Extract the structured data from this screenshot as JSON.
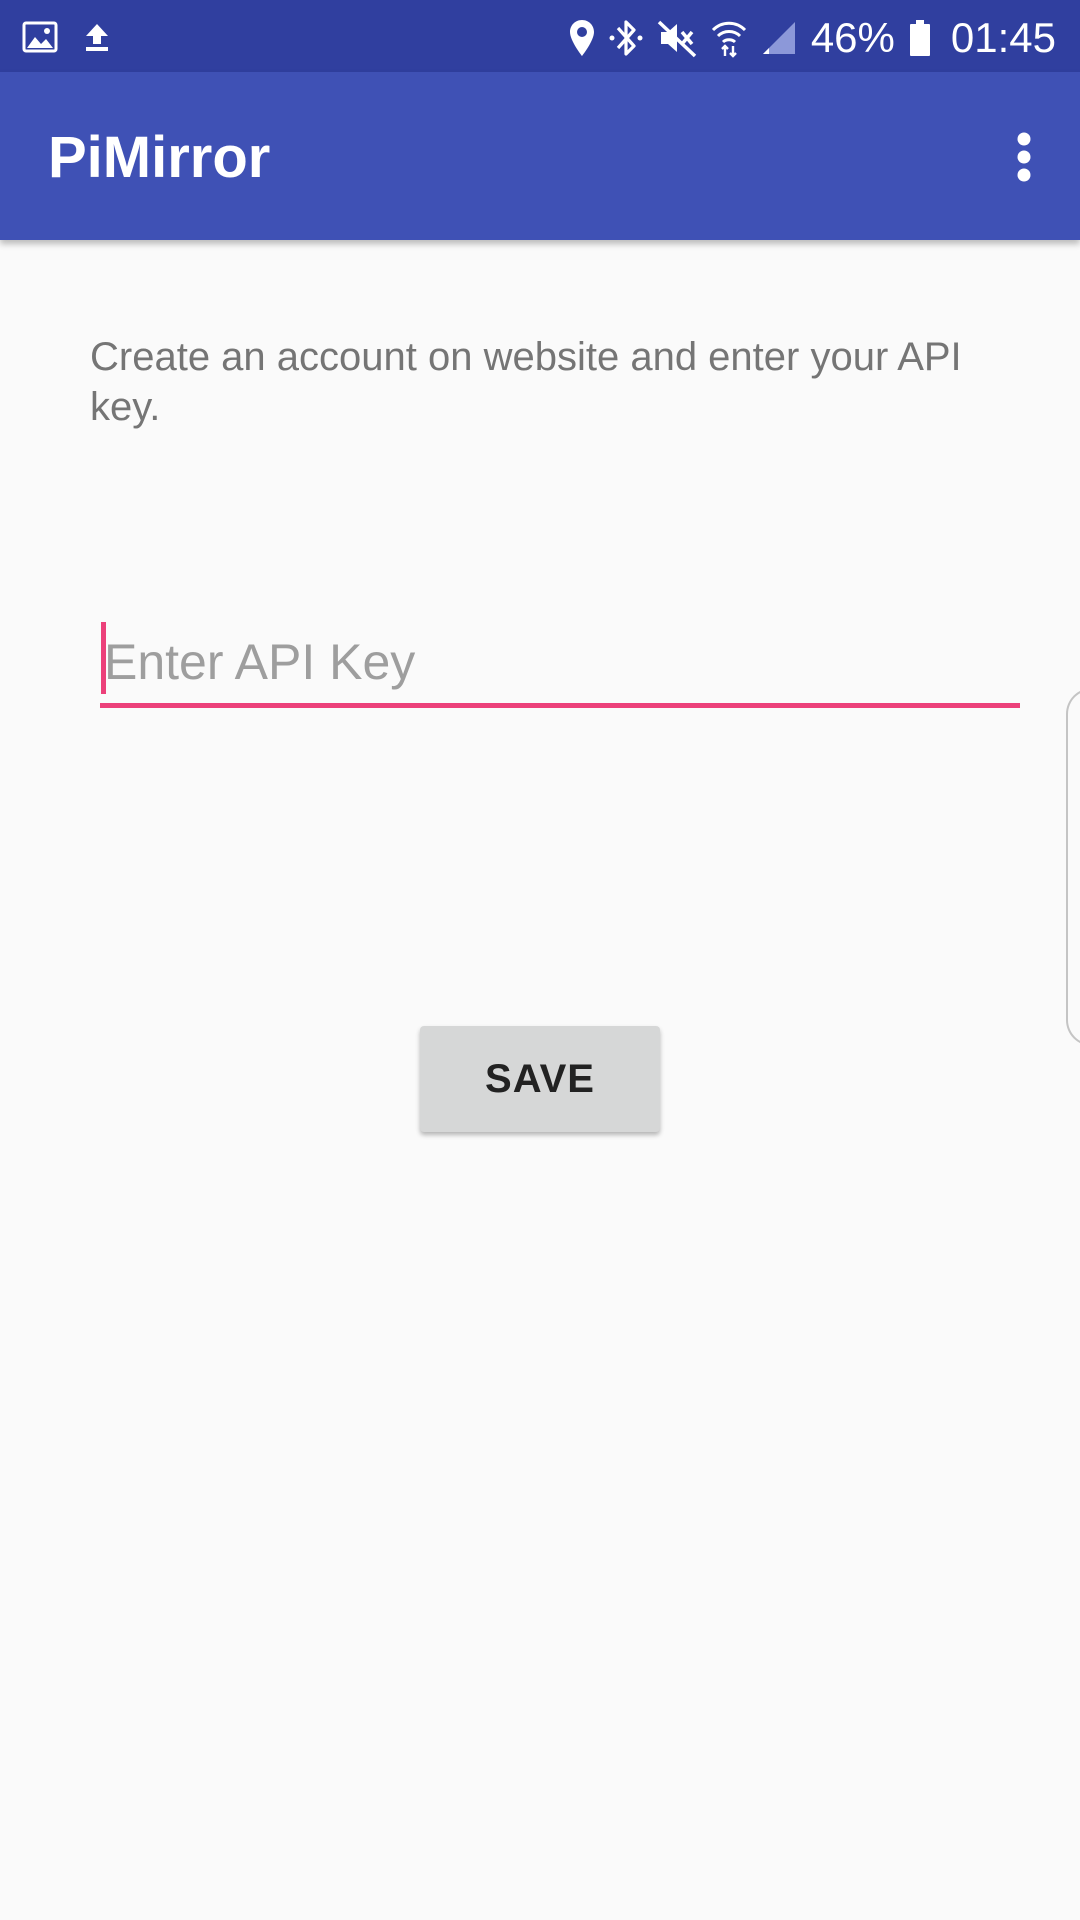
{
  "status_bar": {
    "icons": [
      "gallery-icon",
      "upload-icon",
      "location-icon",
      "bluetooth-icon",
      "mute-icon",
      "wifi-icon",
      "signal-icon",
      "battery-icon"
    ],
    "battery_percent": "46%",
    "time": "01:45"
  },
  "app_bar": {
    "title": "PiMirror",
    "menu_icon": "more-vert-icon"
  },
  "main": {
    "instructions": "Create an account on website and enter your API key.",
    "api_key_input": {
      "value": "",
      "placeholder": "Enter API Key"
    },
    "save_label": "SAVE"
  },
  "colors": {
    "status_bar": "#303f9f",
    "app_bar": "#3f51b5",
    "accent": "#ec407a",
    "background": "#fafafa",
    "button": "#d6d7d7"
  }
}
